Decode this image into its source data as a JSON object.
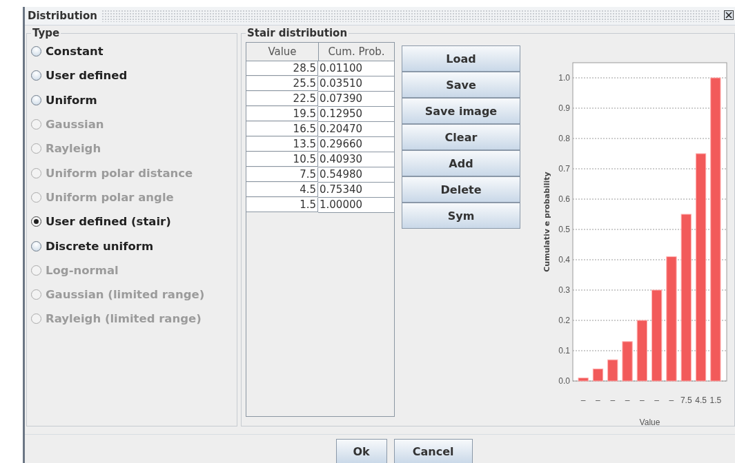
{
  "window": {
    "title": "Distribution"
  },
  "type_panel": {
    "title": "Type",
    "options": [
      {
        "label": "Constant",
        "selected": false,
        "disabled": false
      },
      {
        "label": "User defined",
        "selected": false,
        "disabled": false
      },
      {
        "label": "Uniform",
        "selected": false,
        "disabled": false
      },
      {
        "label": "Gaussian",
        "selected": false,
        "disabled": true
      },
      {
        "label": "Rayleigh",
        "selected": false,
        "disabled": true
      },
      {
        "label": "Uniform polar distance",
        "selected": false,
        "disabled": true
      },
      {
        "label": "Uniform polar angle",
        "selected": false,
        "disabled": true
      },
      {
        "label": "User defined (stair)",
        "selected": true,
        "disabled": false
      },
      {
        "label": "Discrete uniform",
        "selected": false,
        "disabled": false
      },
      {
        "label": "Log-normal",
        "selected": false,
        "disabled": true
      },
      {
        "label": "Gaussian (limited range)",
        "selected": false,
        "disabled": true
      },
      {
        "label": "Rayleigh (limited range)",
        "selected": false,
        "disabled": true
      }
    ]
  },
  "stair_panel": {
    "title": "Stair distribution",
    "table": {
      "columns": [
        "Value",
        "Cum. Prob."
      ],
      "rows": [
        [
          "28.5",
          "0.01100"
        ],
        [
          "25.5",
          "0.03510"
        ],
        [
          "22.5",
          "0.07390"
        ],
        [
          "19.5",
          "0.12950"
        ],
        [
          "16.5",
          "0.20470"
        ],
        [
          "13.5",
          "0.29660"
        ],
        [
          "10.5",
          "0.40930"
        ],
        [
          "7.5",
          "0.54980"
        ],
        [
          "4.5",
          "0.75340"
        ],
        [
          "1.5",
          "1.00000"
        ]
      ]
    },
    "buttons": [
      "Load",
      "Save",
      "Save image",
      "Clear",
      "Add",
      "Delete",
      "Sym"
    ],
    "chart_data": {
      "type": "bar",
      "xlabel": "Value",
      "ylabel": "Cumulativ e probability",
      "categories": [
        "–",
        "–",
        "–",
        "–",
        "–",
        "–",
        "–",
        "7.5",
        "4.5",
        "1.5"
      ],
      "values": [
        0.01,
        0.04,
        0.07,
        0.13,
        0.2,
        0.3,
        0.41,
        0.55,
        0.75,
        1.0
      ],
      "grid": true,
      "ylim": [
        0,
        1.05
      ],
      "yticks": [
        {
          "value": 0,
          "label": "0.0"
        },
        {
          "value": 0.1,
          "label": "0.1"
        },
        {
          "value": 0.2,
          "label": "0.2"
        },
        {
          "value": 0.3,
          "label": "0.3"
        },
        {
          "value": 0.4,
          "label": "0.4"
        },
        {
          "value": 0.5,
          "label": "0.5"
        },
        {
          "value": 0.6,
          "label": "0.6"
        },
        {
          "value": 0.7,
          "label": "0.7"
        },
        {
          "value": 0.8,
          "label": "0.8"
        },
        {
          "value": 0.9,
          "label": "0.9"
        },
        {
          "value": 1,
          "label": "1.0"
        }
      ]
    }
  },
  "footer_buttons": [
    "Ok",
    "Cancel"
  ]
}
